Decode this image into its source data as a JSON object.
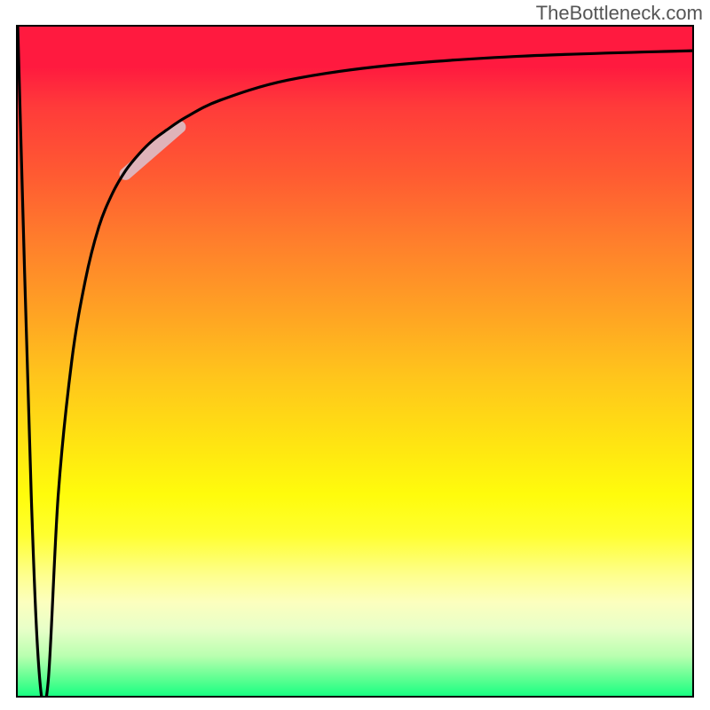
{
  "watermark": "TheBottleneck.com",
  "chart_data": {
    "type": "line",
    "title": "",
    "xlabel": "",
    "ylabel": "",
    "xlim": [
      0,
      100
    ],
    "ylim": [
      0,
      100
    ],
    "grid": false,
    "series": [
      {
        "name": "curve",
        "x": [
          0,
          2,
          3.3,
          4.5,
          6,
          8,
          10,
          12,
          14,
          16,
          18,
          20,
          22,
          25,
          30,
          40,
          55,
          75,
          100
        ],
        "y": [
          100,
          30,
          2,
          2,
          30,
          50,
          62,
          70,
          75,
          78.5,
          81,
          83,
          84.5,
          86.5,
          89,
          92,
          94.2,
          95.6,
          96.4
        ]
      }
    ],
    "highlight_segment": {
      "x_start": 16,
      "x_end": 24,
      "y_start": 78,
      "y_end": 85
    },
    "background_gradient": [
      "#ff1a3f",
      "#ff3b3a",
      "#ff5a32",
      "#ff7e2c",
      "#ffa024",
      "#ffc41c",
      "#ffe312",
      "#fffc0c",
      "#ffff30",
      "#feff8e",
      "#fcffbe",
      "#e8ffc8",
      "#baffb0",
      "#6aff95",
      "#1aff82"
    ]
  }
}
